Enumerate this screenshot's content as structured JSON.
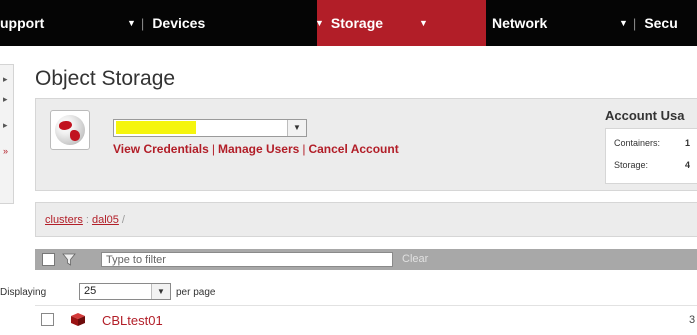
{
  "nav": {
    "items": [
      {
        "label": "upport",
        "active": false
      },
      {
        "label": "Devices",
        "active": false
      },
      {
        "label": "Storage",
        "active": true
      },
      {
        "label": "Network",
        "active": false
      },
      {
        "label": "Secu",
        "active": false
      }
    ],
    "separator": "|",
    "active_color": "#b21e28"
  },
  "page": {
    "title": "Object Storage"
  },
  "account": {
    "selected": "",
    "links": [
      "View Credentials",
      "Manage Users",
      "Cancel Account"
    ],
    "link_separator": "|"
  },
  "usage": {
    "title": "Account Usa",
    "rows": [
      {
        "label": "Containers:",
        "value": "1"
      },
      {
        "label": "Storage:",
        "value": "4"
      }
    ]
  },
  "breadcrumb": {
    "items": [
      "clusters",
      "dal05"
    ],
    "separator_1": ":",
    "separator_2": "/"
  },
  "filter": {
    "placeholder": "Type to filter",
    "clear_label": "Clear"
  },
  "paging": {
    "label": "Displaying",
    "per_page_value": "25",
    "suffix": "per page"
  },
  "containers": [
    {
      "name": "CBLtest01",
      "count": "3"
    }
  ],
  "icons": {
    "nav_dropdown": "chevron-down-icon",
    "globe": "globe-icon",
    "filter": "funnel-icon",
    "container": "container-icon"
  }
}
